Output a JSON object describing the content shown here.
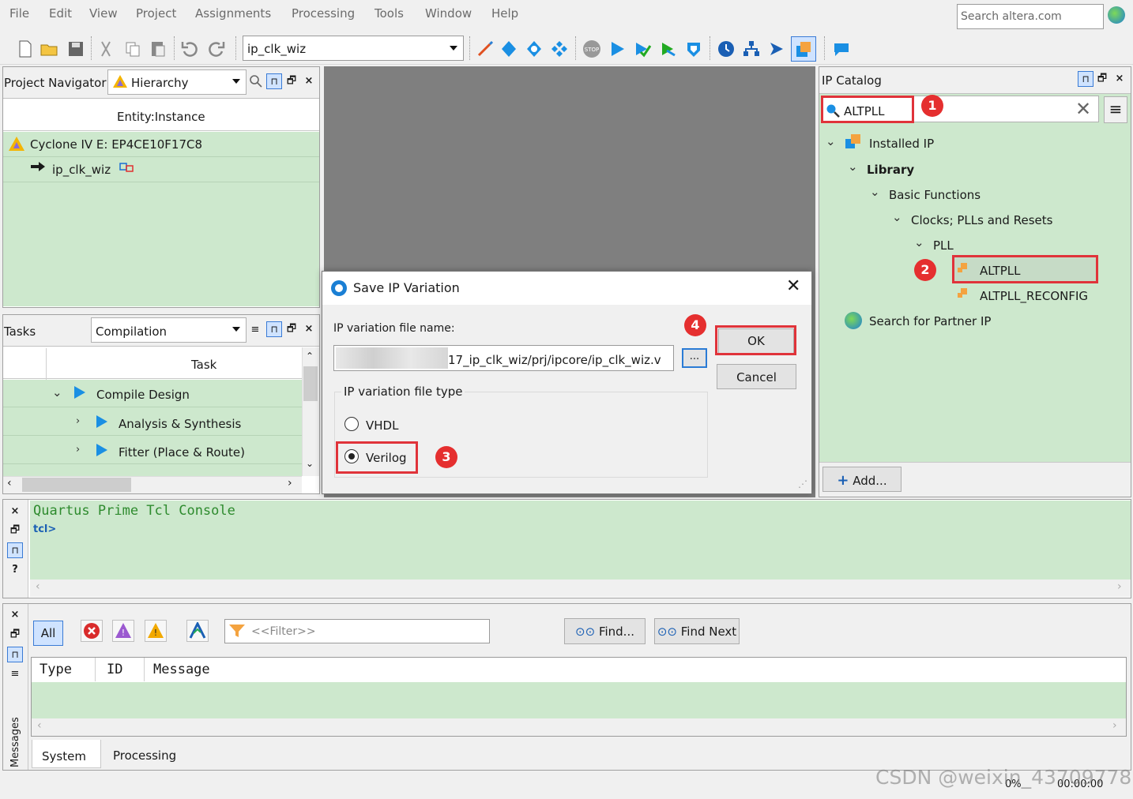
{
  "menu": [
    "File",
    "Edit",
    "View",
    "Project",
    "Assignments",
    "Processing",
    "Tools",
    "Window",
    "Help"
  ],
  "search": {
    "placeholder": "Search altera.com"
  },
  "toolbar": {
    "entity_value": "ip_clk_wiz"
  },
  "project_navigator": {
    "title": "Project Navigator",
    "view_select": "Hierarchy",
    "column_header": "Entity:Instance",
    "device": "Cyclone IV E: EP4CE10F17C8",
    "instance": "ip_clk_wiz"
  },
  "tasks": {
    "title": "Tasks",
    "flow_select": "Compilation",
    "column_header": "Task",
    "items": [
      "Compile Design",
      "Analysis & Synthesis",
      "Fitter (Place & Route)"
    ]
  },
  "ip_catalog": {
    "title": "IP Catalog",
    "search_value": "ALTPLL",
    "tree": {
      "installed": "Installed IP",
      "library": "Library",
      "basic": "Basic Functions",
      "clocks": "Clocks; PLLs and Resets",
      "pll": "PLL",
      "altpll": "ALTPLL",
      "altpll_reconfig": "ALTPLL_RECONFIG",
      "partner": "Search for Partner IP"
    },
    "add_label": "Add..."
  },
  "dialog": {
    "title": "Save IP Variation",
    "file_name_label": "IP variation file name:",
    "file_name_value": "17_ip_clk_wiz/prj/ipcore/ip_clk_wiz.v",
    "browse_label": "...",
    "ok_label": "OK",
    "cancel_label": "Cancel",
    "file_type_label": "IP variation file type",
    "options": [
      "VHDL",
      "Verilog"
    ],
    "selected": "Verilog"
  },
  "badges": [
    "1",
    "2",
    "3",
    "4"
  ],
  "console": {
    "title": "Quartus Prime Tcl Console",
    "prompt": "tcl>"
  },
  "messages": {
    "all_label": "All",
    "filter_placeholder": "<<Filter>>",
    "find_label": "Find...",
    "find_next_label": "Find Next",
    "columns": [
      "Type",
      "ID",
      "Message"
    ],
    "tabs": [
      "System",
      "Processing"
    ],
    "side_label": "Messages"
  },
  "status": {
    "progress": "0%",
    "time": "00:00:00"
  },
  "watermark": "CSDN @weixin_43709778",
  "colors": {
    "accent_red": "#e0333a",
    "pane_green": "#cde8cd",
    "console_text": "#2e8b2e"
  }
}
